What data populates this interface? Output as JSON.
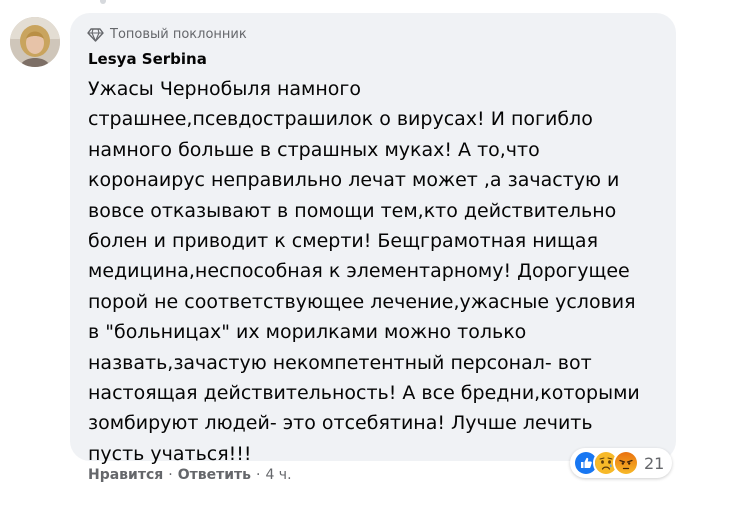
{
  "comment": {
    "badge_label": "Топовый поклонник",
    "badge_icon": "diamond-icon",
    "author": "Lesya Serbina",
    "text_lines": [
      "Ужасы Чернобыля намного",
      "страшнее,псевдострашилок о вирусах! И погибло",
      "намного больше в страшных муках! А то,что",
      "коронаирус неправильно лечат может ,а зачастую и",
      "вовсе отказывают в помощи тем,кто действительно",
      "болен и приводит к смерти! Бещграмотная нищая",
      "медицина,неспособная к элементарному! Дорогущее",
      "порой не соответствующее лечение,ужасные условия",
      "в \"больницах\" их морилками можно только",
      "назвать,зачастую некомпетентный персонал- вот",
      "настоящая действительность! А все бредни,которыми",
      "зомбируют людей- это отсебятина! Лучше лечить",
      "пусть учаться!!!"
    ]
  },
  "actions": {
    "like_label": "Нравится",
    "separator": "·",
    "reply_label": "Ответить",
    "time": "4 ч."
  },
  "reactions": {
    "icons": [
      "like-icon",
      "sad-icon",
      "angry-icon"
    ],
    "count": "21"
  },
  "colors": {
    "bubble_bg": "#f0f2f5",
    "secondary_text": "#65676b",
    "primary_text": "#050505",
    "like_blue": "#1877f2",
    "emoji_yellow": "#f7b928",
    "angry_orange": "#e9710f"
  }
}
